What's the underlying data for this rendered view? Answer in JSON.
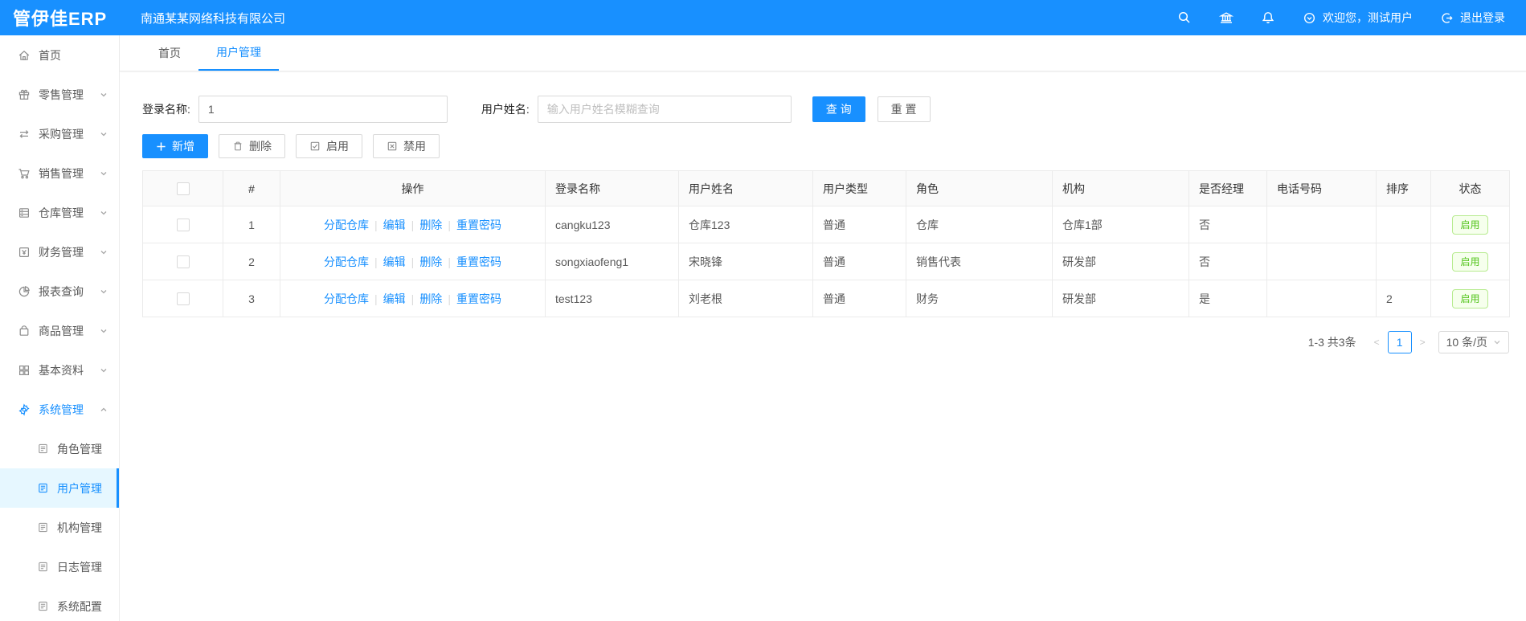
{
  "colors": {
    "primary": "#1890ff",
    "status_green": "#52c41a",
    "active_bg": "#e6f7ff"
  },
  "header": {
    "logo": "管伊佳ERP",
    "company": "南通某某网络科技有限公司",
    "welcome": "欢迎您，测试用户",
    "logout": "退出登录",
    "icons": [
      "search-icon",
      "bank-icon",
      "bell-icon",
      "circle-down-icon",
      "logout-icon"
    ]
  },
  "sidebar": {
    "items": [
      {
        "label": "首页",
        "icon": "home-icon",
        "expandable": false
      },
      {
        "label": "零售管理",
        "icon": "gift-icon",
        "expandable": true
      },
      {
        "label": "采购管理",
        "icon": "swap-icon",
        "expandable": true
      },
      {
        "label": "销售管理",
        "icon": "cart-icon",
        "expandable": true
      },
      {
        "label": "仓库管理",
        "icon": "server-icon",
        "expandable": true
      },
      {
        "label": "财务管理",
        "icon": "account-book-icon",
        "expandable": true
      },
      {
        "label": "报表查询",
        "icon": "pie-chart-icon",
        "expandable": true
      },
      {
        "label": "商品管理",
        "icon": "bag-icon",
        "expandable": true
      },
      {
        "label": "基本资料",
        "icon": "grid-icon",
        "expandable": true
      },
      {
        "label": "系统管理",
        "icon": "gear-icon",
        "expandable": true,
        "expanded": true,
        "active": true,
        "children": [
          {
            "label": "角色管理",
            "active": false
          },
          {
            "label": "用户管理",
            "active": true
          },
          {
            "label": "机构管理",
            "active": false
          },
          {
            "label": "日志管理",
            "active": false
          },
          {
            "label": "系统配置",
            "active": false
          }
        ]
      }
    ]
  },
  "tabs": [
    {
      "label": "首页",
      "active": false
    },
    {
      "label": "用户管理",
      "active": true
    }
  ],
  "filters": {
    "login_name_label": "登录名称:",
    "login_name_value": "1",
    "user_name_label": "用户姓名:",
    "user_name_placeholder": "输入用户姓名模糊查询",
    "search_button": "查 询",
    "reset_button": "重 置"
  },
  "toolbar": {
    "add": "新增",
    "delete": "删除",
    "enable": "启用",
    "disable": "禁用"
  },
  "table": {
    "columns": {
      "index": "#",
      "ops": "操作",
      "login_name": "登录名称",
      "user_name": "用户姓名",
      "user_type": "用户类型",
      "role": "角色",
      "org": "机构",
      "is_manager": "是否经理",
      "phone": "电话号码",
      "sort": "排序",
      "status": "状态"
    },
    "op_links": [
      "分配仓库",
      "编辑",
      "删除",
      "重置密码"
    ],
    "rows": [
      {
        "index": "1",
        "login_name": "cangku123",
        "user_name": "仓库123",
        "user_type": "普通",
        "role": "仓库",
        "org": "仓库1部",
        "is_manager": "否",
        "phone": "",
        "sort": "",
        "status": "启用"
      },
      {
        "index": "2",
        "login_name": "songxiaofeng1",
        "user_name": "宋晓锋",
        "user_type": "普通",
        "role": "销售代表",
        "org": "研发部",
        "is_manager": "否",
        "phone": "",
        "sort": "",
        "status": "启用"
      },
      {
        "index": "3",
        "login_name": "test123",
        "user_name": "刘老根",
        "user_type": "普通",
        "role": "财务",
        "org": "研发部",
        "is_manager": "是",
        "phone": "",
        "sort": "2",
        "status": "启用"
      }
    ]
  },
  "pagination": {
    "total_text": "1-3 共3条",
    "prev": "<",
    "current_page": "1",
    "next": ">",
    "page_size": "10 条/页"
  }
}
